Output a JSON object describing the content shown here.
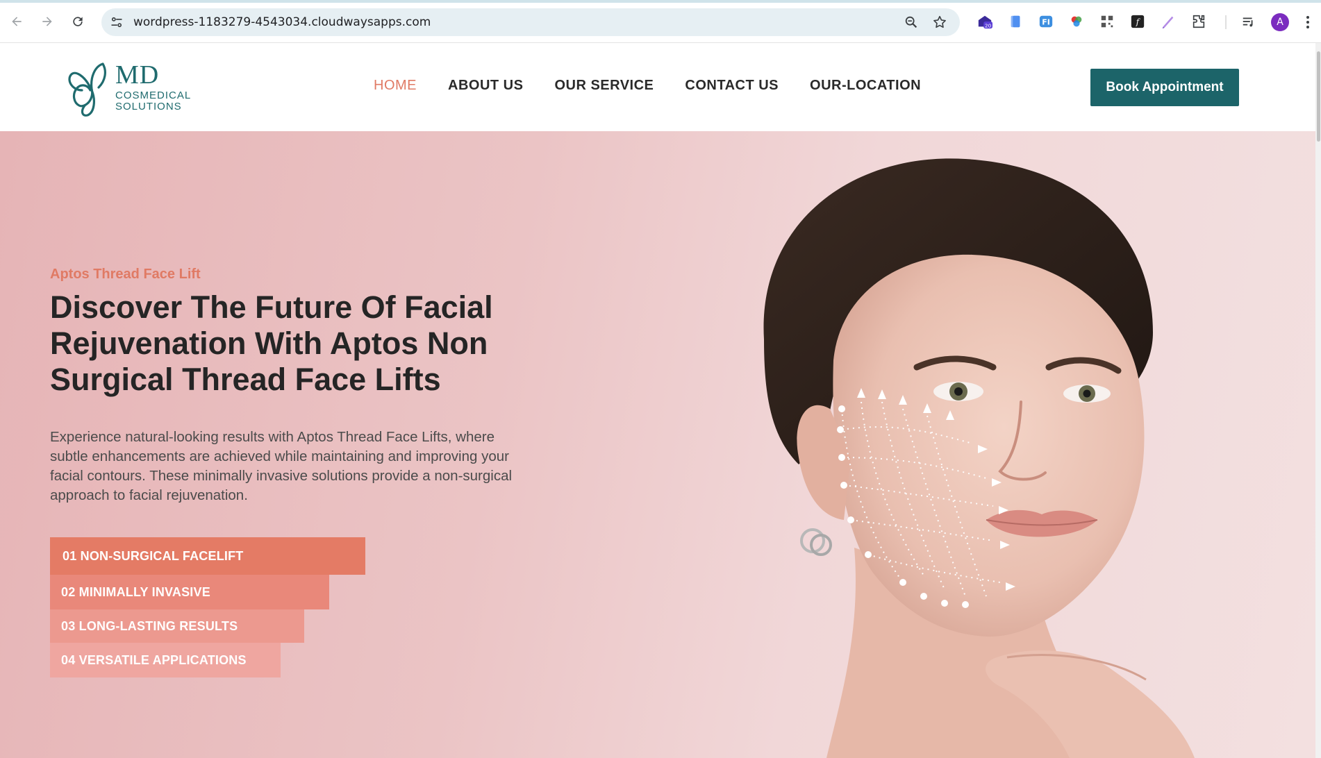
{
  "browser": {
    "url": "wordpress-1183279-4543034.cloudwaysapps.com",
    "extension_badge": "20",
    "avatar_letter": "A",
    "icons": [
      "back-icon",
      "forward-icon",
      "reload-icon",
      "site-settings-icon",
      "zoom-icon",
      "bookmark-star-icon",
      "extension-mail-icon",
      "extension-document-icon",
      "extension-translate-icon",
      "extension-color-icon",
      "extension-qr-icon",
      "extension-font-icon",
      "extension-pen-icon",
      "extensions-puzzle-icon",
      "reading-list-icon",
      "more-menu-icon"
    ]
  },
  "header": {
    "logo": {
      "mark": "MD",
      "line1": "COSMEDICAL",
      "line2": "SOLUTIONS",
      "color": "#1f6b6e"
    },
    "menu": [
      {
        "label": "HOME",
        "active": true
      },
      {
        "label": "ABOUT US",
        "active": false
      },
      {
        "label": "OUR SERVICE",
        "active": false
      },
      {
        "label": "CONTACT US",
        "active": false
      },
      {
        "label": "OUR-LOCATION",
        "active": false
      }
    ],
    "cta_label": "Book Appointment",
    "cta_color": "#1c6469",
    "accent_color": "#e07a64"
  },
  "hero": {
    "eyebrow": "Aptos Thread Face Lift",
    "headline_lines": [
      "Discover The Future Of Facial",
      "Rejuvenation With Aptos Non",
      "Surgical Thread Face Lifts"
    ],
    "description_lines": [
      "Experience natural-looking results with Aptos Thread Face Lifts, where",
      "subtle enhancements are achieved while maintaining and improving your",
      "facial contours. These minimally invasive solutions provide a non-surgical",
      "approach to facial rejuvenation."
    ],
    "features": [
      "01 NON-SURGICAL FACELIFT",
      "02 MINIMALLY INVASIVE",
      "03 LONG-LASTING RESULTS",
      "04 VERSATILE APPLICATIONS"
    ]
  }
}
